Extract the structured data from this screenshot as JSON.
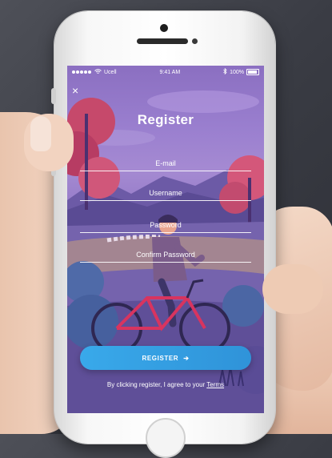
{
  "status_bar": {
    "carrier": "Ucell",
    "time": "9:41 AM",
    "battery": "100%",
    "signal_icon": "signal-dots-icon",
    "wifi_icon": "wifi-icon",
    "bluetooth_icon": "bluetooth-icon"
  },
  "header": {
    "close_symbol": "×",
    "title": "Register"
  },
  "form": {
    "email_placeholder": "E-mail",
    "username_placeholder": "Username",
    "password_placeholder": "Password",
    "confirm_password_placeholder": "Confirm Password",
    "register_label": "REGISTER",
    "register_arrow": "➔"
  },
  "footer": {
    "terms_prefix": "By clicking register, I agree to your ",
    "terms_link": "Terms"
  },
  "colors": {
    "button": "#39a9ea",
    "background_purple": "#8b6fc1"
  }
}
